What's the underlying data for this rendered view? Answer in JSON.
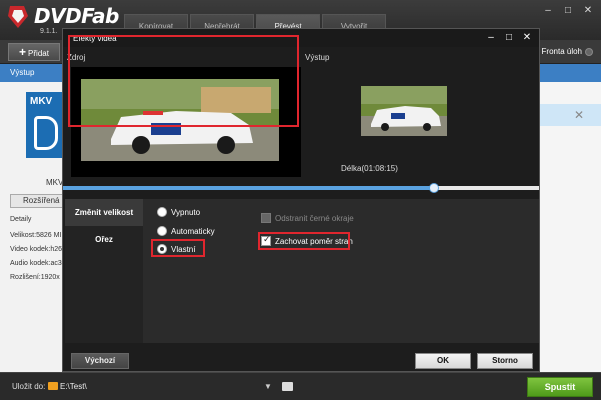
{
  "app": {
    "brand": "DVDFab",
    "version": "9.1.1.",
    "modes": [
      "Kopírovat",
      "Nepřehrát",
      "Převést",
      "Vytvořit"
    ],
    "active_mode": 2,
    "window_controls": [
      "minimize-icon",
      "restore-icon",
      "close-icon"
    ]
  },
  "toolbar": {
    "add_label": "Přidat",
    "queue_label": "Fronta úloh"
  },
  "list": {
    "output_header": "Výstup"
  },
  "source_panel": {
    "format_badge": "MKV",
    "format_sub": "MKV",
    "advanced_label": "Rozšířená n",
    "details_header": "Detaily",
    "details": [
      "Velikost:5826 MI",
      "Video kodek:h26",
      "Audio kodek:ac3",
      "Rozlišení:1920x"
    ]
  },
  "bottom": {
    "save_label": "Uložit do:",
    "path": "E:\\Test\\",
    "start_label": "Spustit"
  },
  "dialog": {
    "title": "Efekty videa",
    "controls": [
      "minimize-icon",
      "maximize-icon",
      "close-icon"
    ],
    "source_label": "Zdroj",
    "output_label": "Výstup",
    "duration": "Délka(01:08:15)",
    "seek_position": 0.78,
    "tabs": [
      "Změnit velikost",
      "Ořez"
    ],
    "active_tab": 0,
    "radio_options": [
      "Vypnuto",
      "Automaticky",
      "Vlastní"
    ],
    "selected_radio": 2,
    "checkbox_remove_borders": "Odstranit černé okraje",
    "checkbox_keep_aspect": "Zachovat poměr stran",
    "keep_aspect_checked": true,
    "remove_borders_enabled": false,
    "default_label": "Výchozí",
    "ok_label": "OK",
    "cancel_label": "Storno",
    "highlight_color": "#e0262e"
  }
}
